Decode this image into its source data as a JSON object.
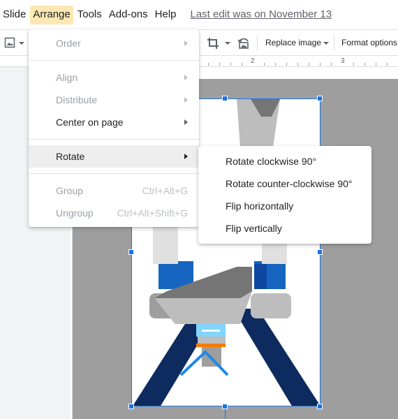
{
  "menubar": {
    "items": [
      "Slide",
      "Arrange",
      "Tools",
      "Add-ons",
      "Help"
    ],
    "active": "Arrange",
    "last_edit": "Last edit was on November 13"
  },
  "toolbar": {
    "replace_image": "Replace image",
    "format_options": "Format options"
  },
  "ruler": {
    "numbers": [
      "2",
      "3"
    ]
  },
  "arrange_menu": {
    "order": "Order",
    "align": "Align",
    "distribute": "Distribute",
    "center_on_page": "Center on page",
    "rotate": "Rotate",
    "group": "Group",
    "group_shortcut": "Ctrl+Alt+G",
    "ungroup": "Ungroup",
    "ungroup_shortcut": "Ctrl+Alt+Shift+G"
  },
  "rotate_submenu": {
    "items": [
      "Rotate clockwise 90°",
      "Rotate counter-clockwise 90°",
      "Flip horizontally",
      "Flip vertically"
    ]
  },
  "colors": {
    "accent": "#1a73e8",
    "menu_active": "#fce8b2",
    "canvas": "#9e9e9e"
  }
}
